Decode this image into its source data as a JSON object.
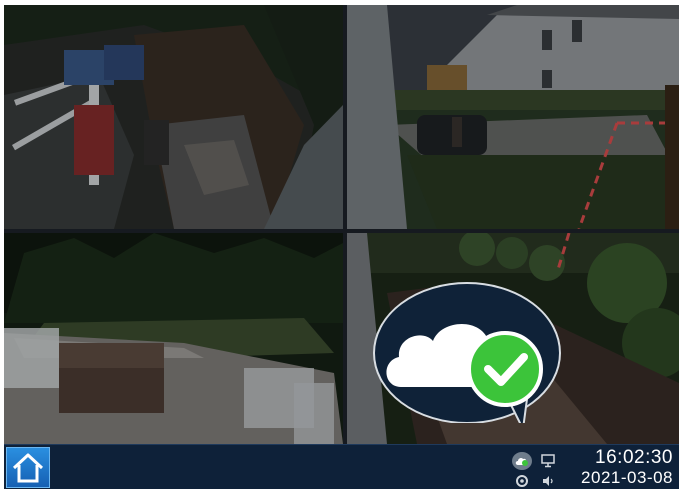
{
  "window": {
    "camera_tiles": [
      {
        "id": "camera-1",
        "scene": "backyard-deck-stairs"
      },
      {
        "id": "camera-2",
        "scene": "front-yard-driveway"
      },
      {
        "id": "camera-3",
        "scene": "backyard-hot-tub-deck"
      },
      {
        "id": "camera-4",
        "scene": "garden-walkway"
      }
    ]
  },
  "popup": {
    "status_icon": "cloud-check-icon",
    "status_color": "#3cc43a"
  },
  "taskbar": {
    "home_icon": "home-icon",
    "accent_color": "#1f78d1",
    "tray": {
      "icons": [
        "cloud-status-icon",
        "monitor-icon",
        "settings-icon",
        "volume-icon"
      ]
    },
    "clock": {
      "time": "16:02:30",
      "date": "2021-03-08"
    }
  }
}
